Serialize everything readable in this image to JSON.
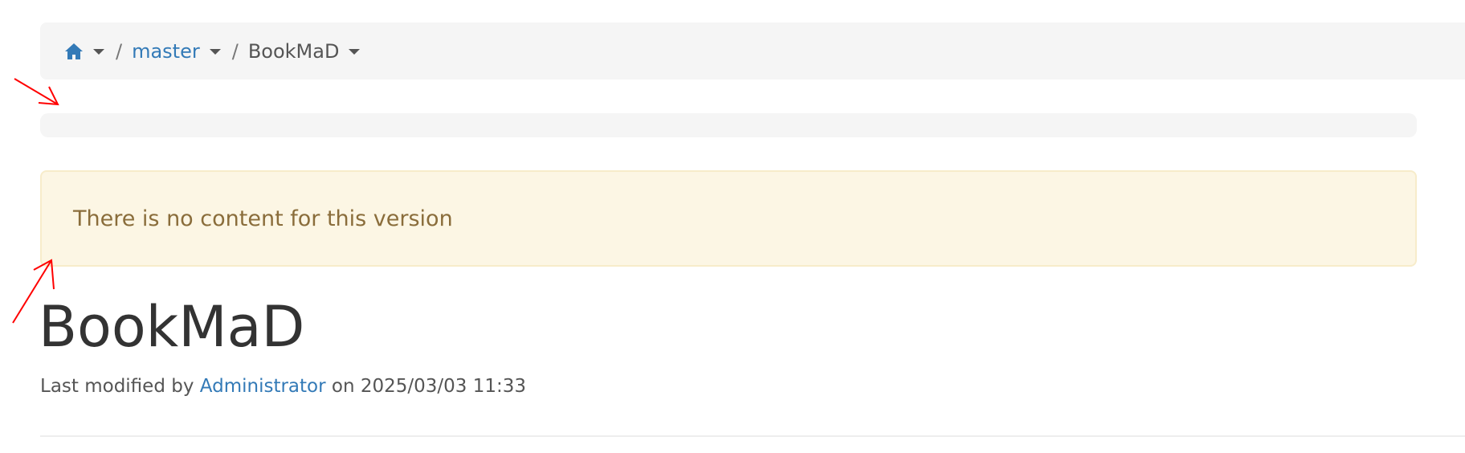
{
  "breadcrumb": {
    "home_icon": "home-icon",
    "items": [
      {
        "label": "master",
        "link": true
      },
      {
        "label": "BookMaD",
        "link": false
      }
    ],
    "separator": "/",
    "colors": {
      "link": "#337ab7",
      "text": "#555555"
    }
  },
  "alert": {
    "message": "There is no content for this version",
    "colors": {
      "background": "#fcf6e4",
      "border": "#f7ecca",
      "text": "#8a6d3b"
    }
  },
  "page": {
    "title": "BookMaD",
    "meta": {
      "prefix": "Last modified by ",
      "author": "Administrator",
      "middle": " on ",
      "date": "2025/03/03 11:33"
    }
  },
  "annotations": {
    "arrows": [
      "arrow-icon",
      "arrow-icon"
    ],
    "color": "#ff0000"
  }
}
